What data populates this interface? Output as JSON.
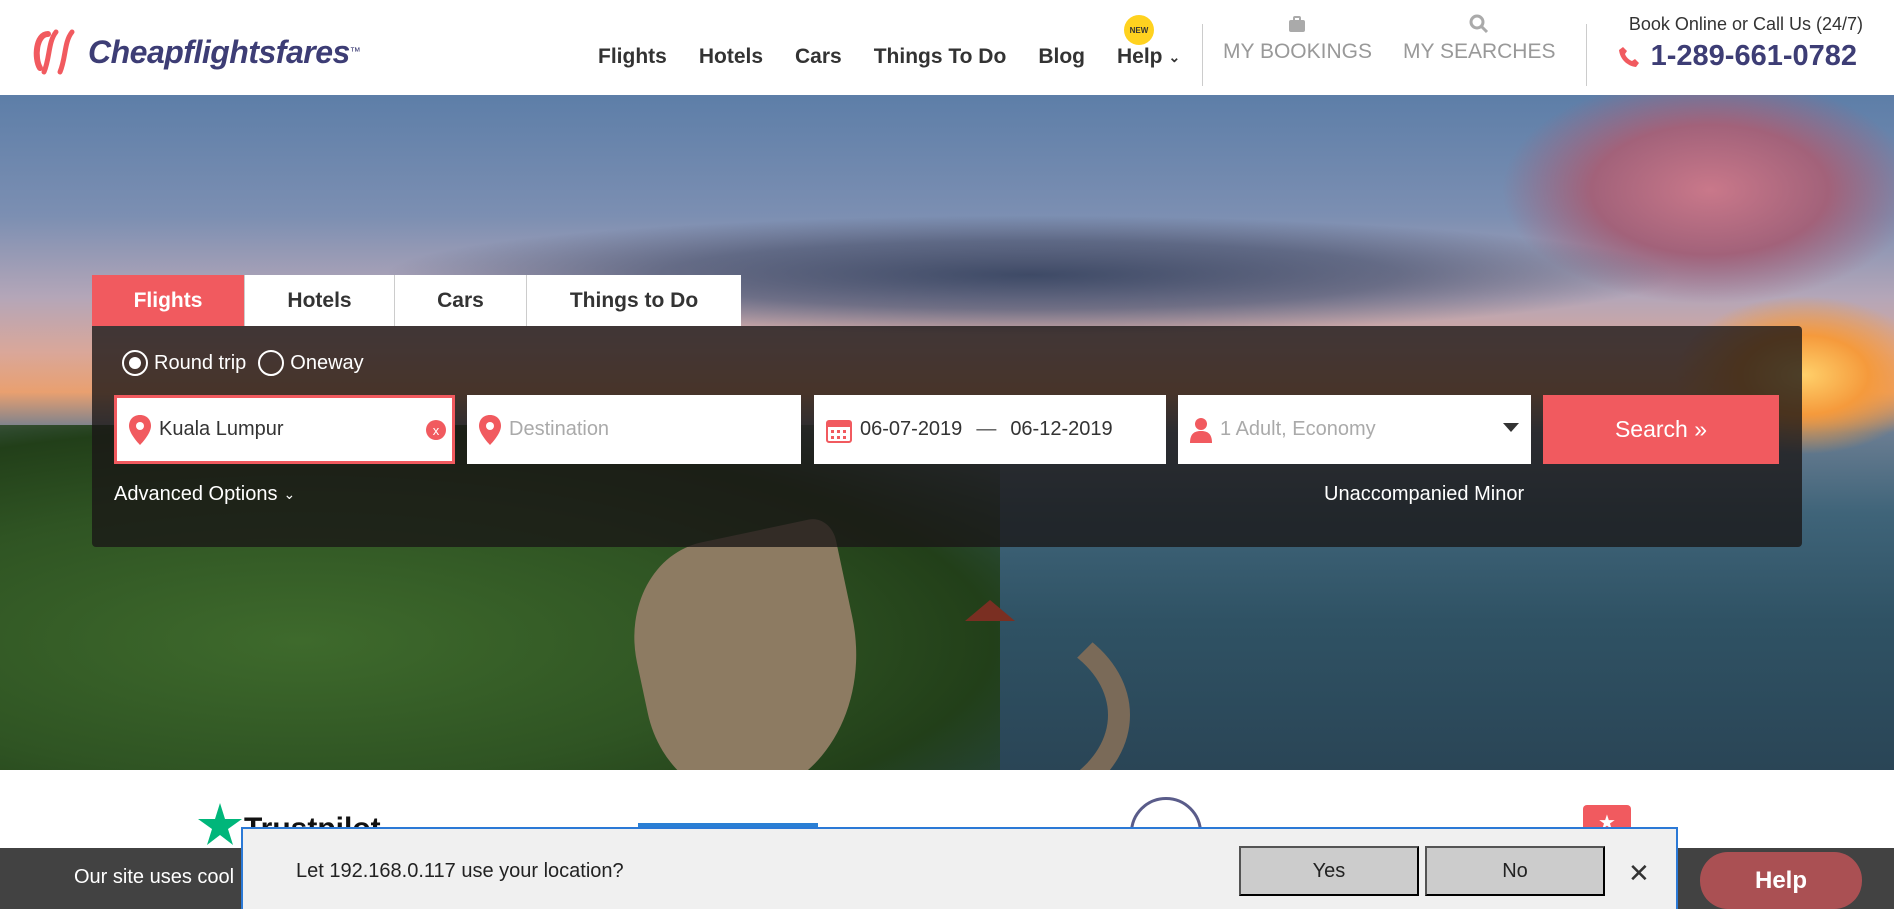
{
  "brand": {
    "logo_text": "Cheapflightsfares",
    "tm": "™",
    "accent": "#f15a5f",
    "navy": "#3d3d75"
  },
  "nav": [
    {
      "label": "Flights"
    },
    {
      "label": "Hotels"
    },
    {
      "label": "Cars"
    },
    {
      "label": "Things To Do"
    },
    {
      "label": "Blog"
    },
    {
      "label": "Help"
    }
  ],
  "help_badge": "NEW",
  "utilities": {
    "bookings_label": "MY BOOKINGS",
    "bookings_icon": "briefcase-icon",
    "searches_label": "MY SEARCHES",
    "searches_icon": "search-icon"
  },
  "contact": {
    "label": "Book Online or Call Us (24/7)",
    "phone": "1-289-661-0782",
    "icon": "phone-icon"
  },
  "search_widget": {
    "tabs": [
      {
        "label": "Flights",
        "active": true
      },
      {
        "label": "Hotels",
        "active": false
      },
      {
        "label": "Cars",
        "active": false
      },
      {
        "label": "Things to Do",
        "active": false
      }
    ],
    "trip_types": [
      {
        "label": "Round trip",
        "selected": true
      },
      {
        "label": "Oneway",
        "selected": false
      }
    ],
    "origin": {
      "value": "Kuala Lumpur",
      "clear": "x"
    },
    "destination": {
      "placeholder": "Destination"
    },
    "dates": {
      "depart": "06-07-2019",
      "return": "06-12-2019",
      "separator": "—"
    },
    "passengers": {
      "value": "1 Adult, Economy"
    },
    "search_button": "Search »",
    "advanced_options": "Advanced Options",
    "unaccompanied_minor": "Unaccompanied Minor"
  },
  "below": {
    "trustpilot_text": "Trustpilot"
  },
  "cookie_banner": {
    "text": "Our site uses cool"
  },
  "help_button": {
    "label": "Help"
  },
  "location_prompt": {
    "message": "Let 192.168.0.117 use your location?",
    "yes": "Yes",
    "no": "No",
    "close": "✕"
  }
}
